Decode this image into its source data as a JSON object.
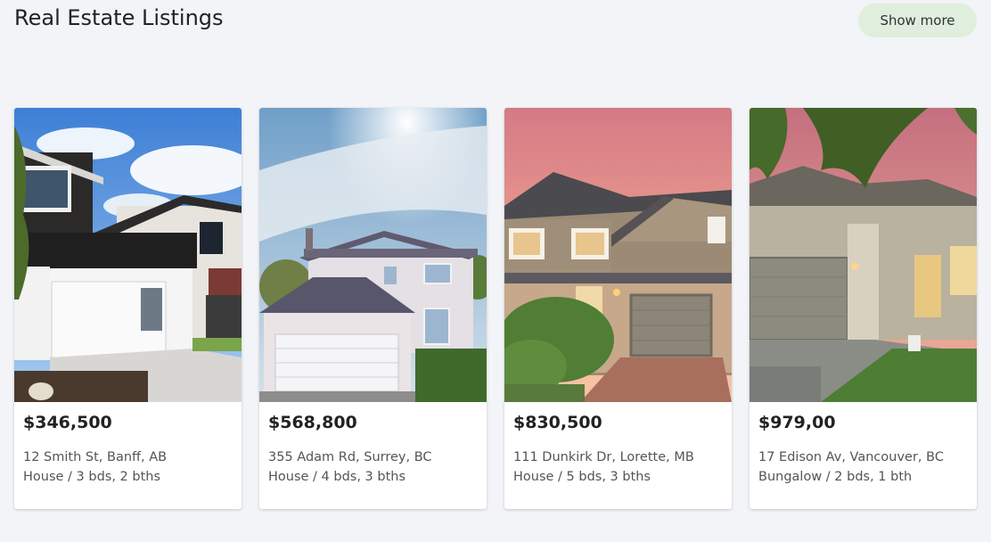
{
  "header": {
    "title": "Real Estate Listings",
    "show_more_label": "Show more"
  },
  "listings": [
    {
      "price": "$346,500",
      "address": "12 Smith St, Banff, AB",
      "details": "House / 3 bds, 2 bths"
    },
    {
      "price": "$568,800",
      "address": "355 Adam Rd, Surrey, BC",
      "details": "House / 4 bds, 3 bths"
    },
    {
      "price": "$830,500",
      "address": "111 Dunkirk Dr, Lorette, MB",
      "details": "House / 5 bds, 3 bths"
    },
    {
      "price": "$979,00",
      "address": "17 Edison Av, Vancouver, BC",
      "details": "Bungalow / 2 bds, 1 bth"
    }
  ],
  "colors": {
    "background": "#f2f4f7",
    "show_more_bg": "#dfeedd",
    "card_bg": "#ffffff"
  }
}
